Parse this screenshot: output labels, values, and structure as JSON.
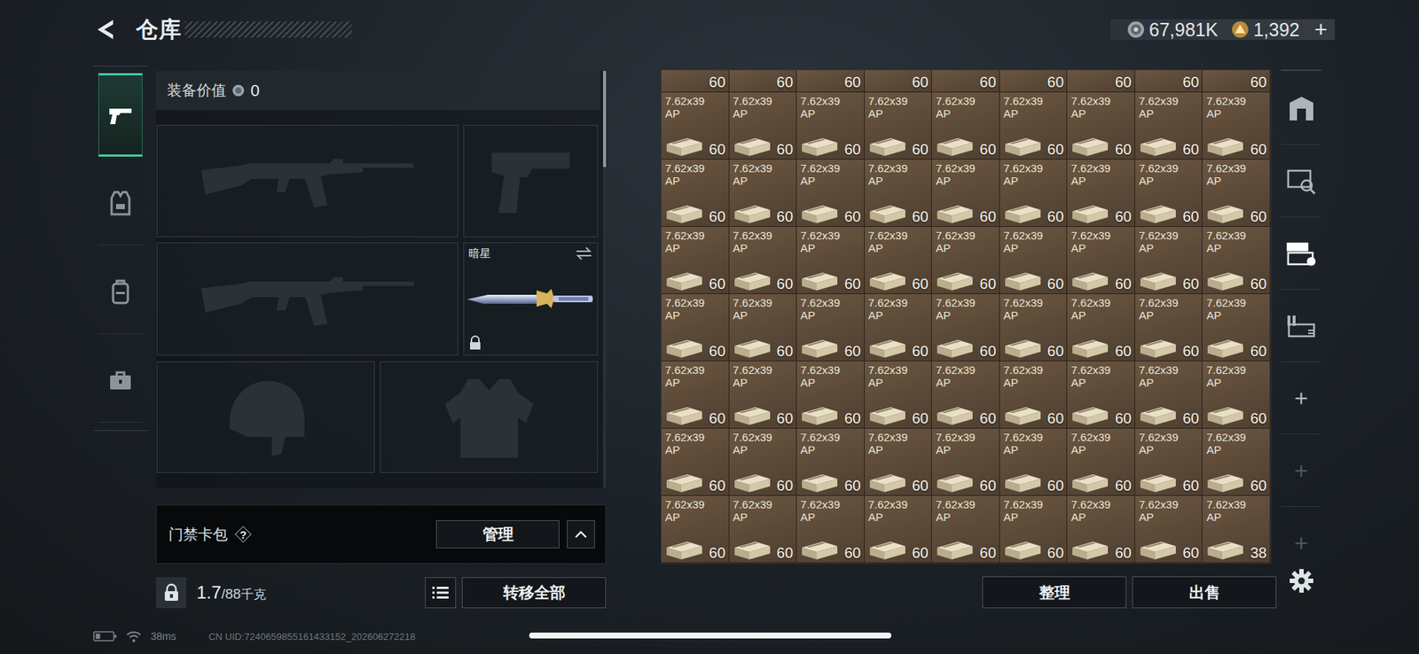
{
  "header": {
    "title": "仓库",
    "currencies": [
      {
        "kind": "silver",
        "amount": "67,981K"
      },
      {
        "kind": "gold",
        "amount": "1,392"
      }
    ],
    "add": "+"
  },
  "tabs": [
    {
      "kind": "pistol",
      "selected": true
    },
    {
      "kind": "gear",
      "selected": false
    },
    {
      "kind": "backpack",
      "selected": false
    },
    {
      "kind": "toolbox",
      "selected": false
    }
  ],
  "equipment": {
    "value_label": "装备价值",
    "value": "0",
    "slots": [
      {
        "kind": "rifle",
        "filled": false
      },
      {
        "kind": "pistol",
        "filled": false
      },
      {
        "kind": "rifle",
        "filled": false
      },
      {
        "kind": "melee",
        "filled": true,
        "name": "暗星",
        "locked": true
      },
      {
        "kind": "helmet",
        "filled": false
      },
      {
        "kind": "armor",
        "filled": false
      }
    ]
  },
  "keycard": {
    "label": "门禁卡包",
    "help": "?",
    "manage": "管理"
  },
  "weight": {
    "current": "1.7",
    "max": "/88",
    "unit": "千克"
  },
  "transfer_all": "转移全部",
  "storage": {
    "cut_row": [
      {
        "count": "60"
      },
      {
        "count": "60"
      },
      {
        "count": "60"
      },
      {
        "count": "60"
      },
      {
        "count": "60"
      },
      {
        "count": "60"
      },
      {
        "count": "60"
      },
      {
        "count": "60"
      },
      {
        "count": "60"
      }
    ],
    "items": [
      {
        "caliber": "7.62x39",
        "type": "AP",
        "count": "60"
      },
      {
        "caliber": "7.62x39",
        "type": "AP",
        "count": "60"
      },
      {
        "caliber": "7.62x39",
        "type": "AP",
        "count": "60"
      },
      {
        "caliber": "7.62x39",
        "type": "AP",
        "count": "60"
      },
      {
        "caliber": "7.62x39",
        "type": "AP",
        "count": "60"
      },
      {
        "caliber": "7.62x39",
        "type": "AP",
        "count": "60"
      },
      {
        "caliber": "7.62x39",
        "type": "AP",
        "count": "60"
      },
      {
        "caliber": "7.62x39",
        "type": "AP",
        "count": "60"
      },
      {
        "caliber": "7.62x39",
        "type": "AP",
        "count": "60"
      },
      {
        "caliber": "7.62x39",
        "type": "AP",
        "count": "60"
      },
      {
        "caliber": "7.62x39",
        "type": "AP",
        "count": "60"
      },
      {
        "caliber": "7.62x39",
        "type": "AP",
        "count": "60"
      },
      {
        "caliber": "7.62x39",
        "type": "AP",
        "count": "60"
      },
      {
        "caliber": "7.62x39",
        "type": "AP",
        "count": "60"
      },
      {
        "caliber": "7.62x39",
        "type": "AP",
        "count": "60"
      },
      {
        "caliber": "7.62x39",
        "type": "AP",
        "count": "60"
      },
      {
        "caliber": "7.62x39",
        "type": "AP",
        "count": "60"
      },
      {
        "caliber": "7.62x39",
        "type": "AP",
        "count": "60"
      },
      {
        "caliber": "7.62x39",
        "type": "AP",
        "count": "60"
      },
      {
        "caliber": "7.62x39",
        "type": "AP",
        "count": "60"
      },
      {
        "caliber": "7.62x39",
        "type": "AP",
        "count": "60"
      },
      {
        "caliber": "7.62x39",
        "type": "AP",
        "count": "60"
      },
      {
        "caliber": "7.62x39",
        "type": "AP",
        "count": "60"
      },
      {
        "caliber": "7.62x39",
        "type": "AP",
        "count": "60"
      },
      {
        "caliber": "7.62x39",
        "type": "AP",
        "count": "60"
      },
      {
        "caliber": "7.62x39",
        "type": "AP",
        "count": "60"
      },
      {
        "caliber": "7.62x39",
        "type": "AP",
        "count": "60"
      },
      {
        "caliber": "7.62x39",
        "type": "AP",
        "count": "60"
      },
      {
        "caliber": "7.62x39",
        "type": "AP",
        "count": "60"
      },
      {
        "caliber": "7.62x39",
        "type": "AP",
        "count": "60"
      },
      {
        "caliber": "7.62x39",
        "type": "AP",
        "count": "60"
      },
      {
        "caliber": "7.62x39",
        "type": "AP",
        "count": "60"
      },
      {
        "caliber": "7.62x39",
        "type": "AP",
        "count": "60"
      },
      {
        "caliber": "7.62x39",
        "type": "AP",
        "count": "60"
      },
      {
        "caliber": "7.62x39",
        "type": "AP",
        "count": "60"
      },
      {
        "caliber": "7.62x39",
        "type": "AP",
        "count": "60"
      },
      {
        "caliber": "7.62x39",
        "type": "AP",
        "count": "60"
      },
      {
        "caliber": "7.62x39",
        "type": "AP",
        "count": "60"
      },
      {
        "caliber": "7.62x39",
        "type": "AP",
        "count": "60"
      },
      {
        "caliber": "7.62x39",
        "type": "AP",
        "count": "60"
      },
      {
        "caliber": "7.62x39",
        "type": "AP",
        "count": "60"
      },
      {
        "caliber": "7.62x39",
        "type": "AP",
        "count": "60"
      },
      {
        "caliber": "7.62x39",
        "type": "AP",
        "count": "60"
      },
      {
        "caliber": "7.62x39",
        "type": "AP",
        "count": "60"
      },
      {
        "caliber": "7.62x39",
        "type": "AP",
        "count": "60"
      },
      {
        "caliber": "7.62x39",
        "type": "AP",
        "count": "60"
      },
      {
        "caliber": "7.62x39",
        "type": "AP",
        "count": "60"
      },
      {
        "caliber": "7.62x39",
        "type": "AP",
        "count": "60"
      },
      {
        "caliber": "7.62x39",
        "type": "AP",
        "count": "60"
      },
      {
        "caliber": "7.62x39",
        "type": "AP",
        "count": "60"
      },
      {
        "caliber": "7.62x39",
        "type": "AP",
        "count": "60"
      },
      {
        "caliber": "7.62x39",
        "type": "AP",
        "count": "60"
      },
      {
        "caliber": "7.62x39",
        "type": "AP",
        "count": "60"
      },
      {
        "caliber": "7.62x39",
        "type": "AP",
        "count": "60"
      },
      {
        "caliber": "7.62x39",
        "type": "AP",
        "count": "60"
      },
      {
        "caliber": "7.62x39",
        "type": "AP",
        "count": "60"
      },
      {
        "caliber": "7.62x39",
        "type": "AP",
        "count": "60"
      },
      {
        "caliber": "7.62x39",
        "type": "AP",
        "count": "60"
      },
      {
        "caliber": "7.62x39",
        "type": "AP",
        "count": "60"
      },
      {
        "caliber": "7.62x39",
        "type": "AP",
        "count": "60"
      },
      {
        "caliber": "7.62x39",
        "type": "AP",
        "count": "60"
      },
      {
        "caliber": "7.62x39",
        "type": "AP",
        "count": "60"
      },
      {
        "caliber": "7.62x39",
        "type": "AP",
        "count": "38"
      }
    ]
  },
  "side_tabs": [
    {
      "kind": "safe",
      "selected": false,
      "disabled": false
    },
    {
      "kind": "card",
      "selected": false,
      "disabled": false
    },
    {
      "kind": "case",
      "selected": true,
      "disabled": false
    },
    {
      "kind": "stack",
      "selected": false,
      "disabled": false
    },
    {
      "kind": "add",
      "label": "+",
      "selected": false,
      "disabled": false
    },
    {
      "kind": "add",
      "label": "+",
      "selected": false,
      "disabled": true
    },
    {
      "kind": "add",
      "label": "+",
      "selected": false,
      "disabled": true
    }
  ],
  "actions": [
    "整理",
    "出售"
  ],
  "status": {
    "ping": "38ms",
    "uid": "CN UID:7240659855161433152_202606272218"
  }
}
